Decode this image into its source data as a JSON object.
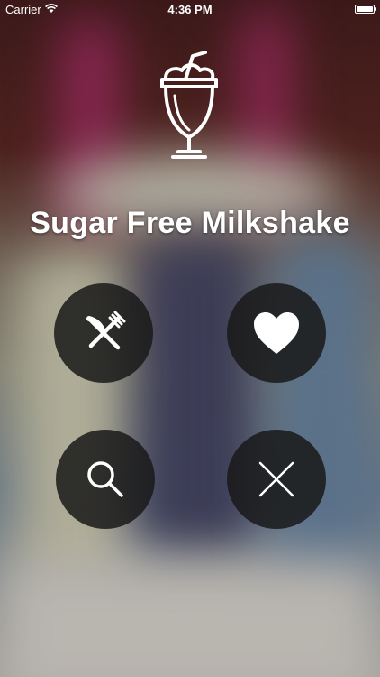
{
  "status_bar": {
    "carrier": "Carrier",
    "time": "4:36 PM",
    "wifi_icon": "wifi-icon",
    "battery_icon": "battery-icon"
  },
  "app": {
    "title": "Sugar Free Milkshake",
    "logo_icon": "milkshake-icon"
  },
  "menu": {
    "buttons": [
      {
        "icon": "fork-knife-icon",
        "action": "recipes"
      },
      {
        "icon": "heart-icon",
        "action": "favorites"
      },
      {
        "icon": "search-icon",
        "action": "search"
      },
      {
        "icon": "close-icon",
        "action": "close"
      }
    ]
  },
  "colors": {
    "button_bg": "#191919",
    "icon_color": "#ffffff"
  }
}
